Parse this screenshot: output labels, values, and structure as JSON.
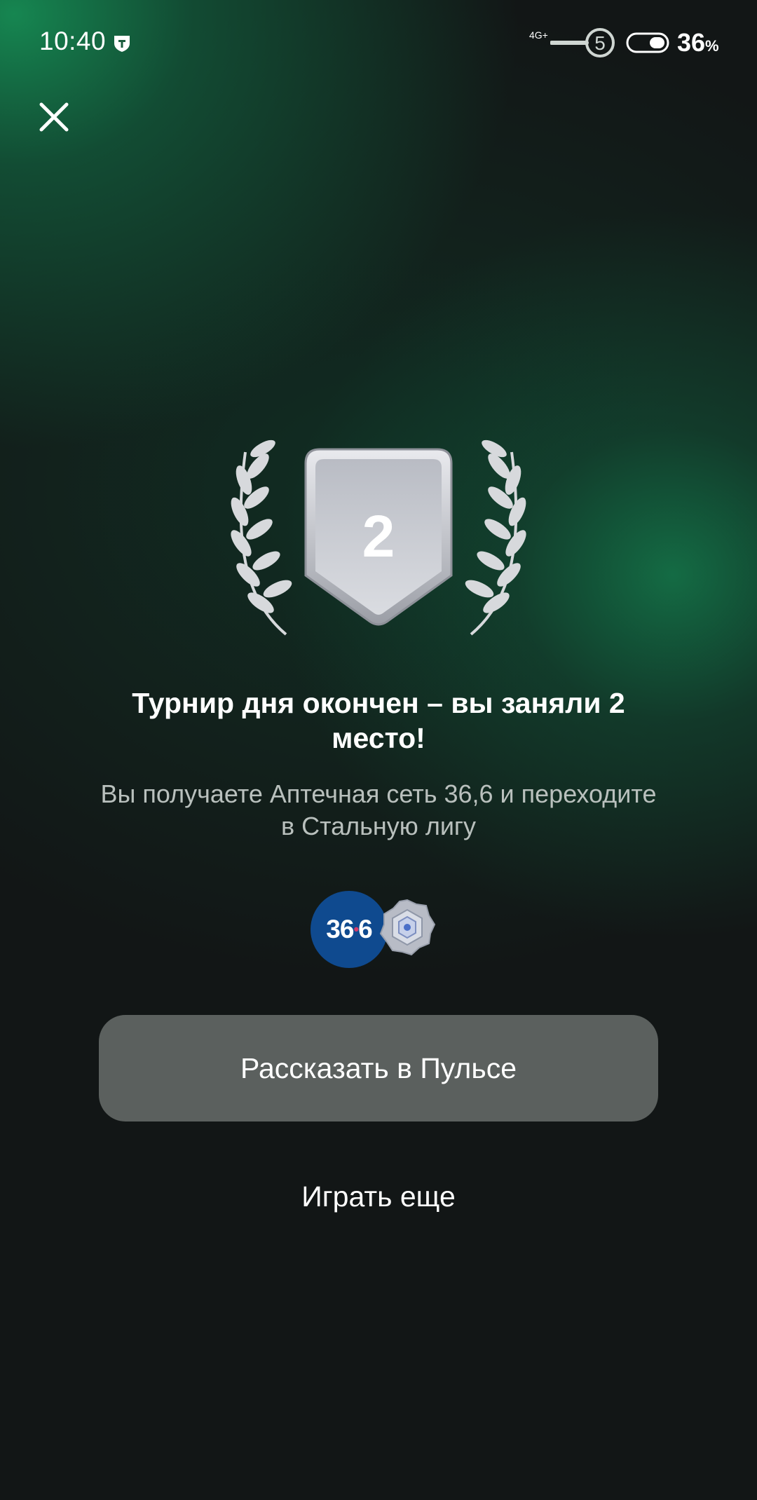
{
  "status_bar": {
    "time": "10:40",
    "network": "4G+",
    "sim": "5",
    "battery_value": "36",
    "battery_unit": "%"
  },
  "icons": {
    "close": "close-icon",
    "tele2": "tele2-icon",
    "signal": "signal-icon",
    "battery": "battery-icon",
    "laurel": "laurel-icon",
    "league": "steel-league-icon"
  },
  "result": {
    "place": "2",
    "title": "Турнир дня окончен – вы заняли 2 место!",
    "subtitle": "Вы получаете Аптечная сеть 36,6 и переходите в Стальную лигу"
  },
  "rewards": {
    "badge_left": "36",
    "badge_dot": "•",
    "badge_right": "6"
  },
  "actions": {
    "share_label": "Рассказать в Пульсе",
    "play_again_label": "Играть еще"
  },
  "colors": {
    "background": "#121616",
    "accent_green": "#168c54",
    "button_bg": "#5b605e",
    "subtitle_text": "#b9c0bd",
    "badge_blue": "#0f4a8f"
  }
}
